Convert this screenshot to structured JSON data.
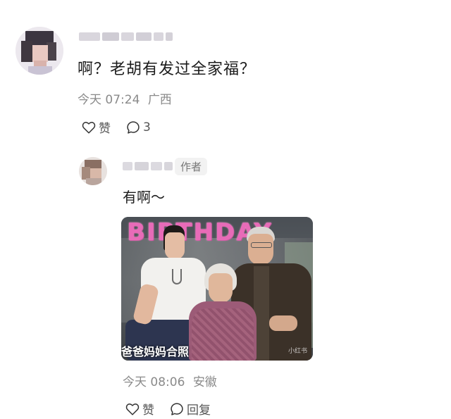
{
  "comment": {
    "text": "啊？老胡有发过全家福？",
    "time": "今天 07:24",
    "location": "广西",
    "like_label": "赞",
    "reply_count": "3"
  },
  "reply": {
    "badge": "作者",
    "text": "有啊～",
    "photo": {
      "banner_text": "BIRTHDAY",
      "caption": "爸爸妈妈合照",
      "watermark": "小红书"
    },
    "time": "今天 08:06",
    "location": "安徽",
    "like_label": "赞",
    "reply_label": "回复"
  },
  "icons": {
    "like": "heart-icon",
    "comment": "speech-bubble-icon"
  }
}
